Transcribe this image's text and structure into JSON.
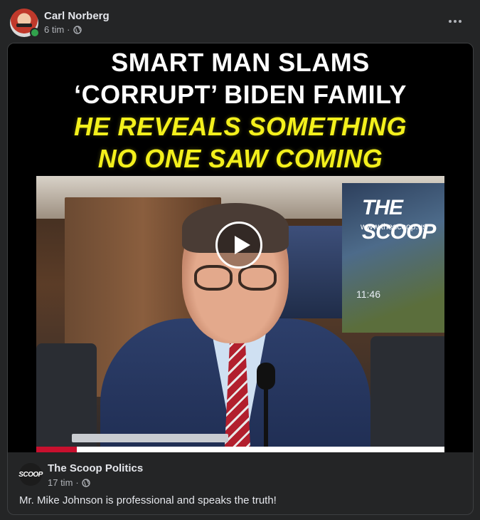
{
  "post": {
    "author_name": "Carl Norberg",
    "time": "6 tim",
    "separator": "·",
    "privacy_icon": "globe-icon",
    "more_icon": "more-horizontal-icon"
  },
  "video": {
    "headline_line1": "SMART MAN SLAMS",
    "headline_line2": "‘CORRUPT’ BIDEN FAMILY",
    "headline_line3": "HE REVEALS SOMETHING",
    "headline_line4": "NO ONE SAW COMING",
    "watermark_logo": "THE SCOOP",
    "watermark_url": "www.thescoop.us",
    "clock_text": "11:46",
    "play_icon": "play-icon",
    "progress_fraction": 0.1
  },
  "shared_post": {
    "page_name": "The Scoop Politics",
    "page_avatar_text": "SCOOP",
    "time": "17 tim",
    "separator": "·",
    "caption": "Mr. Mike Johnson is professional and speaks the truth!"
  },
  "colors": {
    "background": "#242526",
    "headline_white": "#ffffff",
    "headline_yellow": "#f3f01c",
    "progress_red": "#c8102e",
    "online_green": "#31a24c"
  }
}
